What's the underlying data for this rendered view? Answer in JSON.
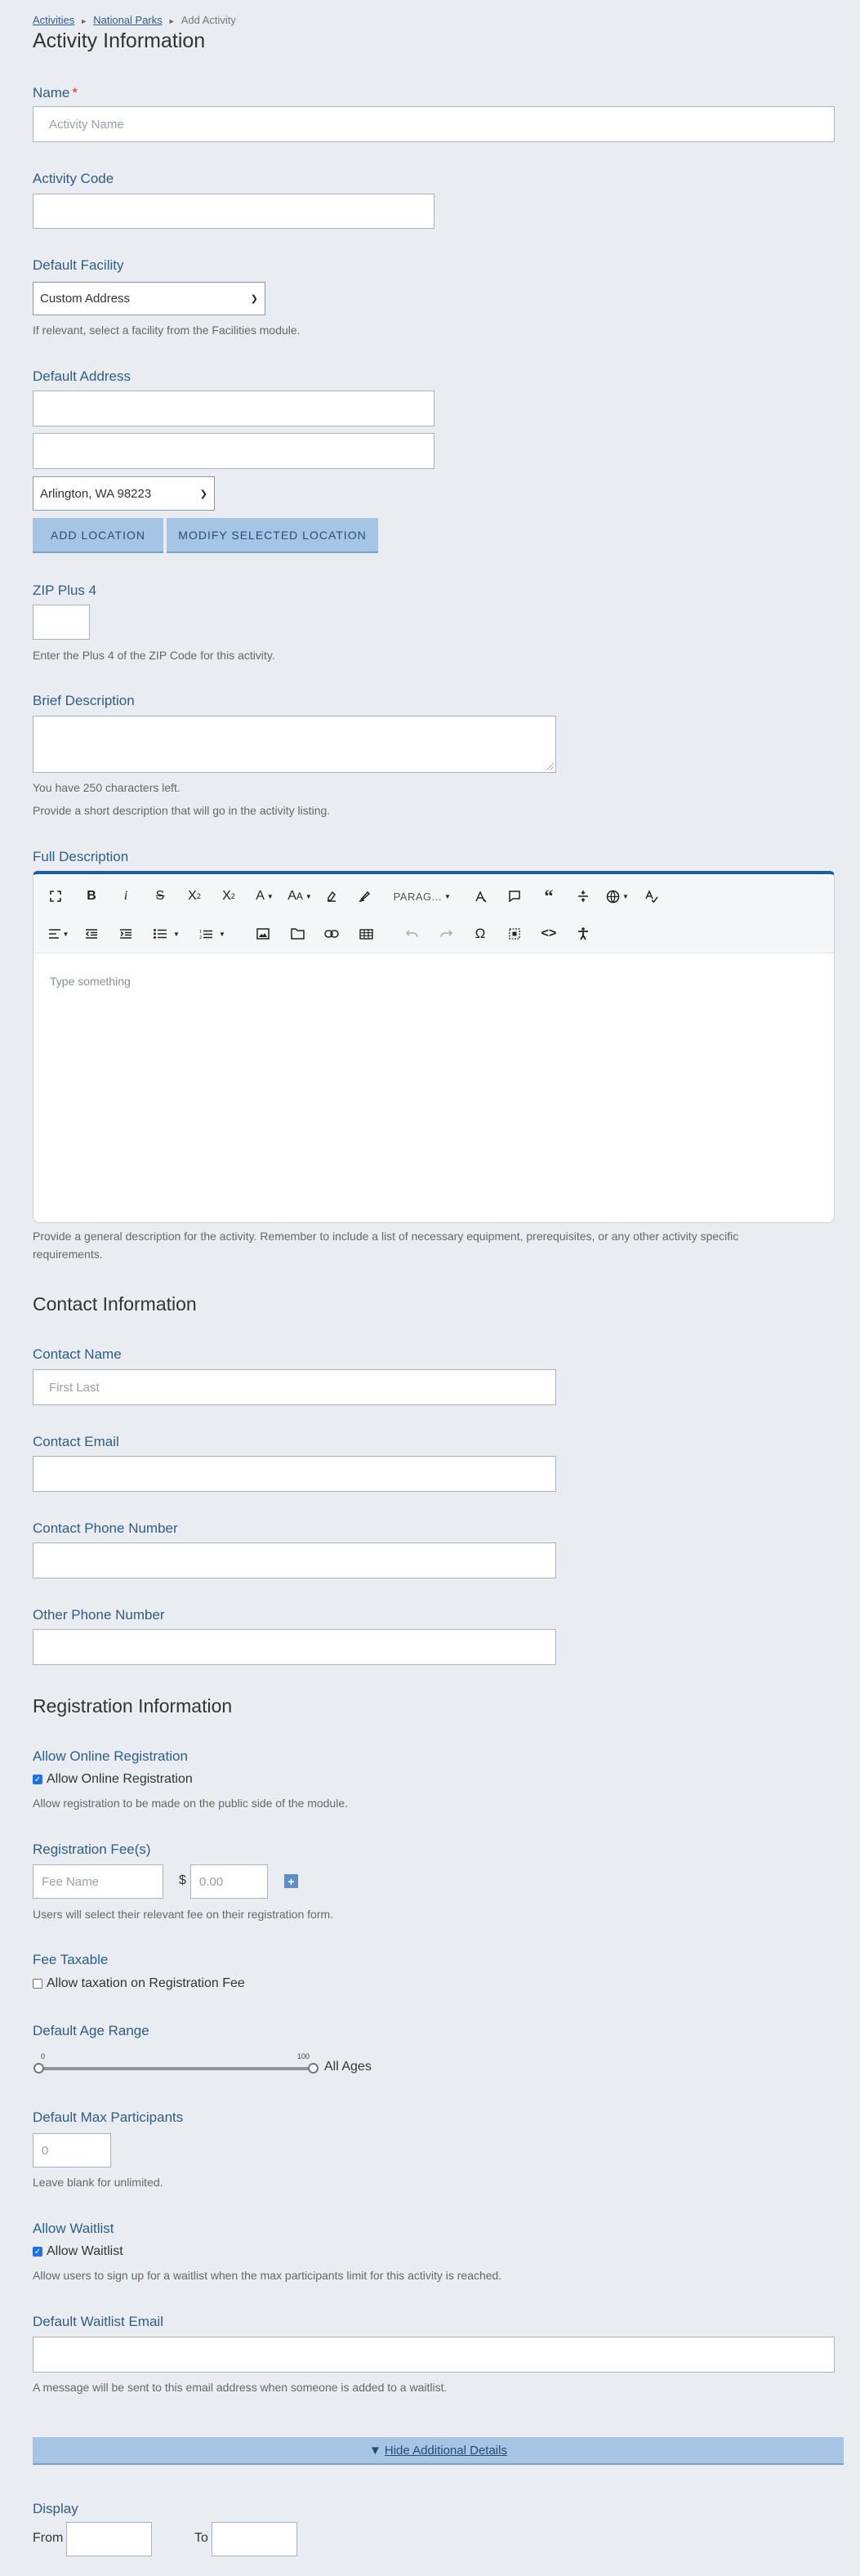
{
  "breadcrumb": {
    "items": [
      "Activities",
      "National Parks"
    ],
    "current": "Add Activity"
  },
  "headings": {
    "activity": "Activity Information",
    "contact": "Contact Information",
    "registration": "Registration Information"
  },
  "name": {
    "label": "Name",
    "required_mark": "*",
    "placeholder": "Activity Name"
  },
  "activity_code": {
    "label": "Activity Code"
  },
  "default_facility": {
    "label": "Default Facility",
    "selected": "Custom Address",
    "help": "If relevant, select a facility from the Facilities module."
  },
  "default_address": {
    "label": "Default Address",
    "city_selected": "Arlington, WA 98223",
    "add_button": "ADD LOCATION",
    "modify_button": "MODIFY SELECTED LOCATION"
  },
  "zip4": {
    "label": "ZIP Plus 4",
    "help": "Enter the Plus 4 of the ZIP Code for this activity."
  },
  "brief_description": {
    "label": "Brief Description",
    "chars_left": "You have 250 characters left.",
    "help": "Provide a short description that will go in the activity listing."
  },
  "full_description": {
    "label": "Full Description",
    "placeholder": "Type something",
    "paragraph_select": "PARAG...",
    "help_line1": "Provide a general description for the activity. Remember to include a list of necessary equipment, prerequisites, or any other activity specific",
    "help_line2": "requirements.",
    "toolbar_icons": [
      "fullscreen-icon",
      "bold-icon",
      "italic-icon",
      "strikethrough-icon",
      "subscript-icon",
      "superscript-icon",
      "font-color-icon",
      "font-size-icon",
      "text-color-icon",
      "highlight-icon",
      "paragraph-format-select",
      "clear-format-icon",
      "comment-icon",
      "quote-icon",
      "horizontal-line-icon",
      "language-icon",
      "spellcheck-icon",
      "align-icon",
      "outdent-icon",
      "indent-icon",
      "bulleted-list-icon",
      "numbered-list-icon",
      "image-icon",
      "file-icon",
      "link-icon",
      "table-icon",
      "undo-icon",
      "redo-icon",
      "special-char-icon",
      "embed-icon",
      "code-view-icon",
      "accessibility-icon"
    ]
  },
  "contact": {
    "name_label": "Contact Name",
    "name_placeholder": "First Last",
    "email_label": "Contact Email",
    "phone_label": "Contact Phone Number",
    "other_phone_label": "Other Phone Number"
  },
  "registration": {
    "online_label": "Allow Online Registration",
    "online_checkbox": "Allow Online Registration",
    "online_checked": true,
    "online_help": "Allow registration to be made on the public side of the module.",
    "fees_label": "Registration Fee(s)",
    "fee_name_placeholder": "Fee Name",
    "currency": "$",
    "fee_amount_placeholder": "0.00",
    "fees_help": "Users will select their relevant fee on their registration form.",
    "taxable_label": "Fee Taxable",
    "taxable_checkbox": "Allow taxation on Registration Fee",
    "taxable_checked": false,
    "age_label": "Default Age Range",
    "age_min_tick": "0",
    "age_max_tick": "100",
    "age_value_text": "All Ages",
    "age_min": 0,
    "age_max": 100,
    "max_label": "Default Max Participants",
    "max_placeholder": "0",
    "max_help": "Leave blank for unlimited.",
    "waitlist_label": "Allow Waitlist",
    "waitlist_checkbox": "Allow Waitlist",
    "waitlist_checked": true,
    "waitlist_help": "Allow users to sign up for a waitlist when the max participants limit for this activity is reached.",
    "waitlist_email_label": "Default Waitlist Email",
    "waitlist_email_help": "A message will be sent to this email address when someone is added to a waitlist."
  },
  "additional_toggle": {
    "arrow": "▼",
    "label": "Hide Additional Details"
  },
  "display": {
    "label": "Display",
    "from_label": "From",
    "to_label": "To"
  },
  "colors": {
    "accent": "#2e5d87",
    "button_bg": "#a6c4e4",
    "editor_border": "#1f5c9b",
    "page_bg": "#e9edf1"
  }
}
